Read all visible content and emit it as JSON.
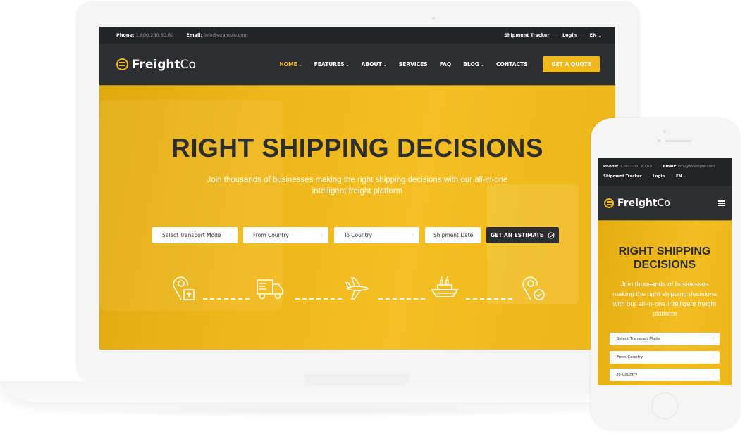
{
  "desktop": {
    "topbar": {
      "phone_label": "Phone:",
      "phone_value": "1.800.260.60.60",
      "email_label": "Email:",
      "email_value": "info@example.com",
      "shipment_tracker": "Shipment Tracker",
      "login": "Login",
      "language": "EN"
    },
    "logo": {
      "bold": "Freight",
      "light": "Co"
    },
    "nav": [
      {
        "label": "HOME",
        "dropdown": true,
        "active": true
      },
      {
        "label": "FEATURES",
        "dropdown": true,
        "active": false
      },
      {
        "label": "ABOUT",
        "dropdown": true,
        "active": false
      },
      {
        "label": "SERVICES",
        "dropdown": false,
        "active": false
      },
      {
        "label": "FAQ",
        "dropdown": false,
        "active": false
      },
      {
        "label": "BLOG",
        "dropdown": true,
        "active": false
      },
      {
        "label": "CONTACTS",
        "dropdown": false,
        "active": false
      }
    ],
    "quote_button": "GET A QUOTE",
    "hero": {
      "title": "RIGHT SHIPPING DECISIONS",
      "subtitle": "Join thousands of businesses making the right shipping decisions with our all-in-one intelligent freight platform",
      "form": {
        "transport_mode": "Select Transport Mode",
        "from_country": "From Country",
        "to_country": "To Country",
        "shipment_date": "Shipment Date",
        "estimate_button": "GET AN ESTIMATE"
      },
      "steps": [
        "location-upload-icon",
        "truck-icon",
        "airplane-icon",
        "ship-icon",
        "location-check-icon"
      ]
    }
  },
  "mobile": {
    "topbar": {
      "phone_label": "Phone:",
      "phone_value": "1.800.260.60.60",
      "email_label": "Email:",
      "email_value": "info@example.com",
      "shipment_tracker": "Shipment Tracker",
      "login": "Login",
      "language": "EN"
    },
    "logo": {
      "bold": "Freight",
      "light": "Co"
    },
    "hero": {
      "title": "RIGHT SHIPPING DECISIONS",
      "subtitle": "Join thousands of businesses making the right shipping decisions with our all-in-one intelligent freight platform",
      "form": {
        "transport_mode": "Select Transport Mode",
        "from_country": "From Country",
        "to_country": "To Country"
      }
    }
  },
  "colors": {
    "accent": "#f2b91c",
    "dark": "#2d2e32",
    "topbar": "#232427"
  }
}
